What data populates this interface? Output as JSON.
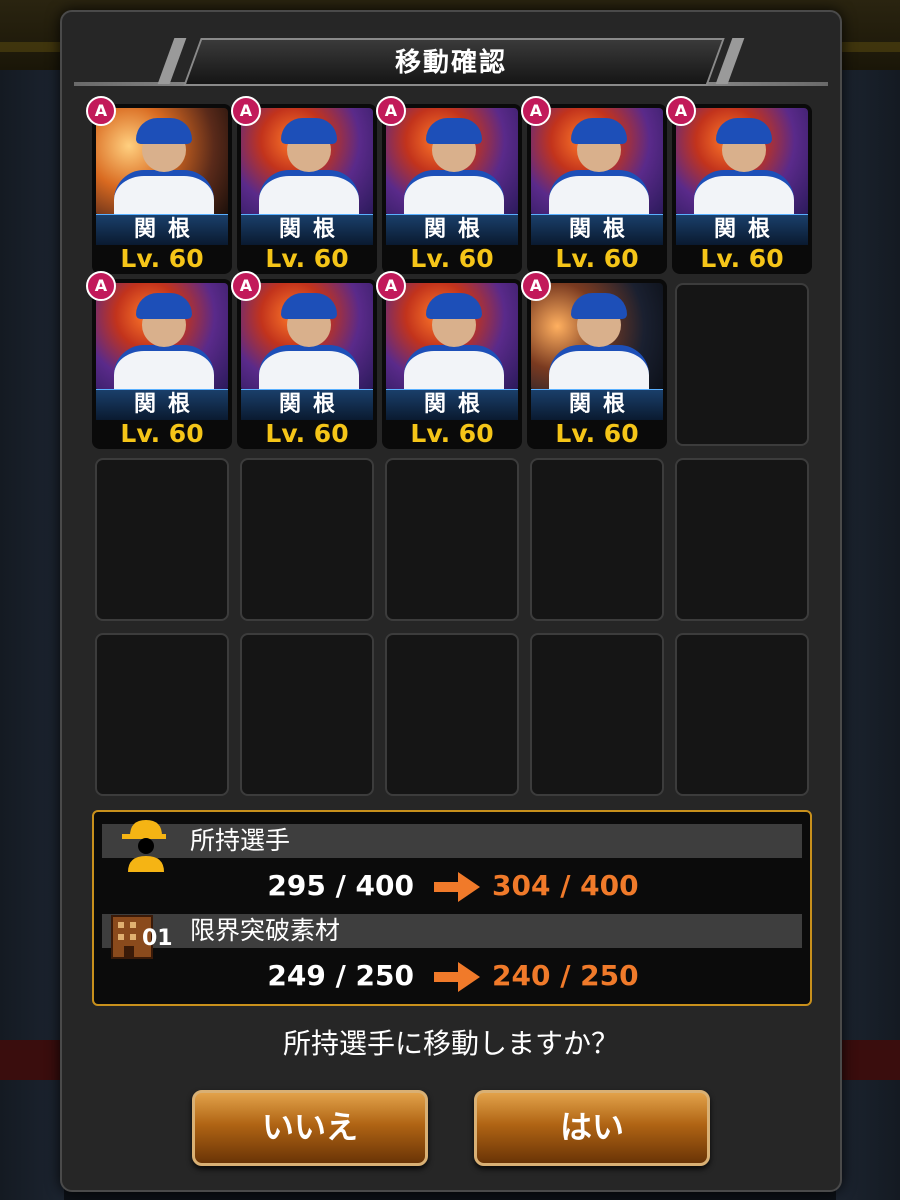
{
  "dialog": {
    "title": "移動確認"
  },
  "cards": [
    {
      "rank": "A",
      "name": "関根",
      "level": "Lv. 60",
      "art": "alt"
    },
    {
      "rank": "A",
      "name": "関根",
      "level": "Lv. 60",
      "art": "fire"
    },
    {
      "rank": "A",
      "name": "関根",
      "level": "Lv. 60",
      "art": "fire"
    },
    {
      "rank": "A",
      "name": "関根",
      "level": "Lv. 60",
      "art": "fire"
    },
    {
      "rank": "A",
      "name": "関根",
      "level": "Lv. 60",
      "art": "fire"
    },
    {
      "rank": "A",
      "name": "関根",
      "level": "Lv. 60",
      "art": "fire"
    },
    {
      "rank": "A",
      "name": "関根",
      "level": "Lv. 60",
      "art": "fire"
    },
    {
      "rank": "A",
      "name": "関根",
      "level": "Lv. 60",
      "art": "fire"
    },
    {
      "rank": "A",
      "name": "関根",
      "level": "Lv. 60",
      "art": "night"
    }
  ],
  "empty_slots": 11,
  "summary": {
    "owned_players": {
      "label": "所持選手",
      "current": "295 / 400",
      "after": "304 / 400"
    },
    "limit_break": {
      "label": "限界突破素材",
      "icon_number": "01",
      "current": "249 / 250",
      "after": "240 / 250"
    }
  },
  "question": "所持選手に移動しますか？",
  "buttons": {
    "no": "いいえ",
    "yes": "はい"
  },
  "colors": {
    "accent_orange": "#f07a2a",
    "level_yellow": "#f5c518",
    "rank_badge": "#c21a5a",
    "frame_gold": "#c8901c"
  }
}
